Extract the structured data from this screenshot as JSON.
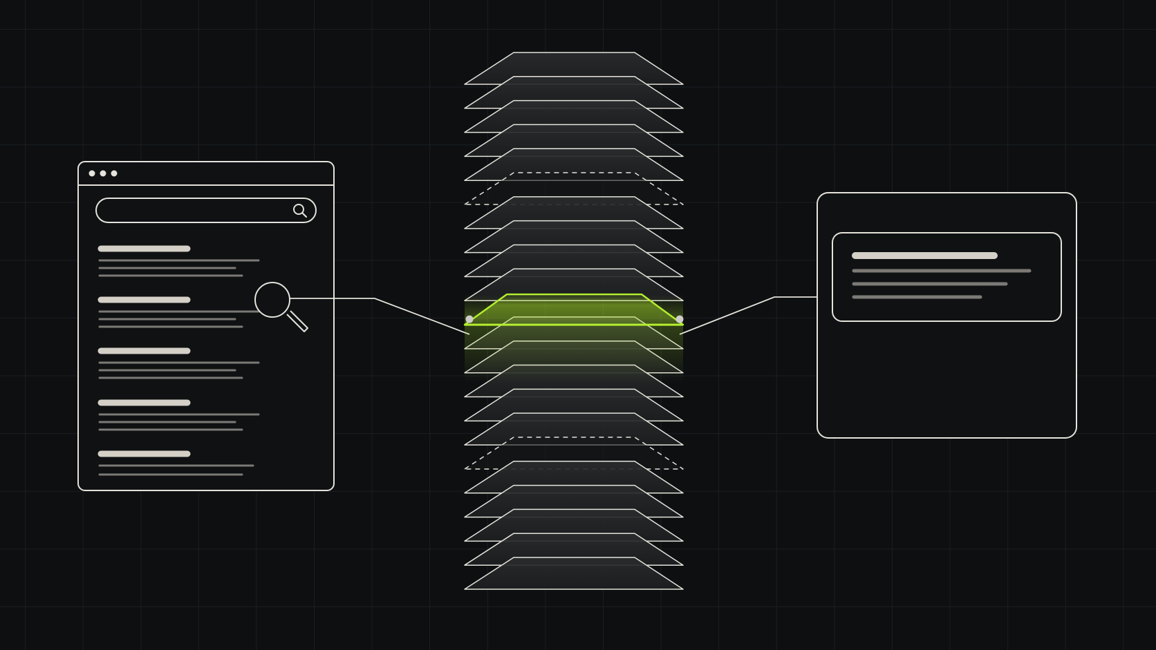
{
  "colors": {
    "background": "#0d0f11",
    "grid": "#1b1e21",
    "stroke": "#e6e3dc",
    "layer_fill": "#1f2123",
    "highlight": "#b5ee2f",
    "skeleton_heading": "#d4d0c7",
    "skeleton_line": "#7c7a76"
  },
  "icons": {
    "search": "search-icon",
    "magnifier": "magnifier-icon",
    "window_controls": "window-dots-icon"
  },
  "browser_window": {
    "control_dots": 3,
    "result_items": [
      {
        "lines": 3
      },
      {
        "lines": 3
      },
      {
        "lines": 3
      },
      {
        "lines": 3
      },
      {
        "lines": 2
      }
    ]
  },
  "layer_stack": {
    "layer_count": 22,
    "dashed_layers": [
      5,
      16
    ],
    "highlighted_layer": 10
  },
  "result_panel": {
    "card_lines": 3
  }
}
